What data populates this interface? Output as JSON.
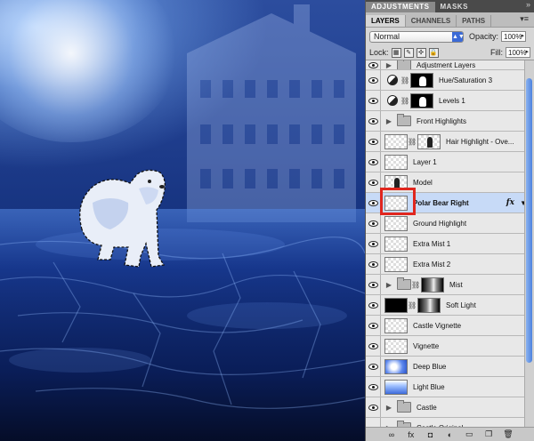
{
  "dock_tabs": [
    "ADJUSTMENTS",
    "MASKS"
  ],
  "panel_tabs": [
    "LAYERS",
    "CHANNELS",
    "PATHS"
  ],
  "blend_mode": "Normal",
  "opacity_label": "Opacity:",
  "opacity_value": "100%",
  "lock_label": "Lock:",
  "fill_label": "Fill:",
  "fill_value": "100%",
  "layers": [
    {
      "name": "Adjustment Layers",
      "type": "folder",
      "partial": true
    },
    {
      "name": "Hue/Saturation 3",
      "type": "adjustment",
      "mask": "mask"
    },
    {
      "name": "Levels 1",
      "type": "adjustment",
      "mask": "mask"
    },
    {
      "name": "Front Highlights",
      "type": "folder"
    },
    {
      "name": "Hair Highlight - Ove...",
      "type": "pixel",
      "thumb": "trans",
      "mask": "figure"
    },
    {
      "name": "Layer 1",
      "type": "pixel",
      "thumb": "trans"
    },
    {
      "name": "Model",
      "type": "pixel",
      "thumb": "figure"
    },
    {
      "name": "Polar Bear Right",
      "type": "pixel",
      "thumb": "trans",
      "selected": true,
      "fx": "fx"
    },
    {
      "name": "Ground Highlight",
      "type": "pixel",
      "thumb": "trans"
    },
    {
      "name": "Extra Mist 1",
      "type": "pixel",
      "thumb": "trans"
    },
    {
      "name": "Extra Mist 2",
      "type": "pixel",
      "thumb": "trans"
    },
    {
      "name": "Mist",
      "type": "folder",
      "mask": "mist"
    },
    {
      "name": "Soft Light",
      "type": "pixel",
      "thumb": "black",
      "mask": "mist"
    },
    {
      "name": "Castle Vignette",
      "type": "pixel",
      "thumb": "trans"
    },
    {
      "name": "Vignette",
      "type": "pixel",
      "thumb": "trans"
    },
    {
      "name": "Deep Blue",
      "type": "pixel",
      "thumb": "deepblue"
    },
    {
      "name": "Light Blue",
      "type": "pixel",
      "thumb": "blue"
    },
    {
      "name": "Castle",
      "type": "folder"
    },
    {
      "name": "Castle Original",
      "type": "folder",
      "hidden": true
    }
  ],
  "footer_icons": [
    "link-icon",
    "fx-icon",
    "mask-icon",
    "adjustment-icon",
    "folder-icon",
    "new-layer-icon",
    "trash-icon"
  ],
  "footer_glyphs": [
    "∞",
    "fx",
    "◘",
    "◐",
    "▭",
    "❐",
    "🗑"
  ],
  "accent_color": "#e0261e",
  "selection_color": "#c7daf7"
}
